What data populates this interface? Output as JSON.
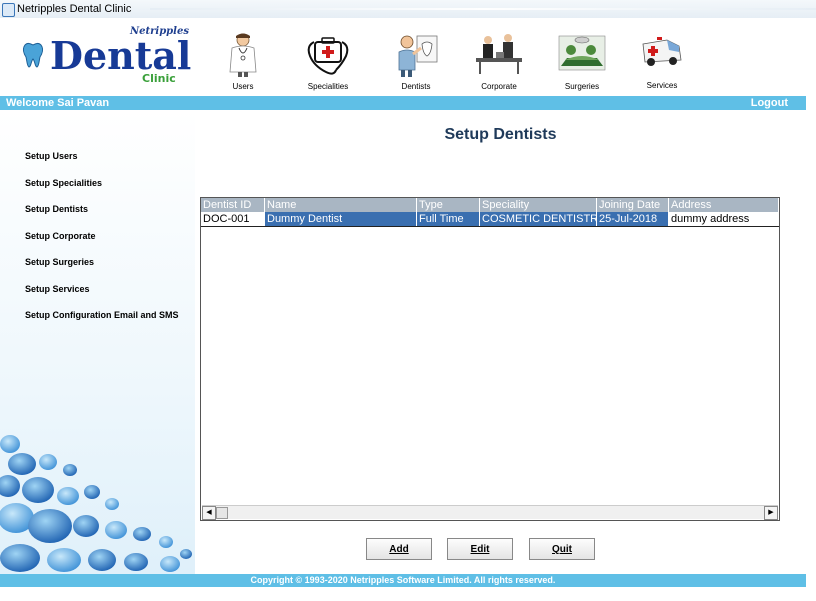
{
  "window": {
    "title": "Netripples Dental Clinic"
  },
  "logo": {
    "brand_small": "Netripples",
    "brand_main": "Dental",
    "brand_sub": "Clinic"
  },
  "nav": [
    {
      "id": "users",
      "label": "Users",
      "icon": "doctor-icon"
    },
    {
      "id": "specialities",
      "label": "Specialities",
      "icon": "medical-kit-icon"
    },
    {
      "id": "dentists",
      "label": "Dentists",
      "icon": "dentist-icon"
    },
    {
      "id": "corporate",
      "label": "Corporate",
      "icon": "corporate-icon"
    },
    {
      "id": "surgeries",
      "label": "Surgeries",
      "icon": "surgery-icon"
    },
    {
      "id": "services",
      "label": "Services",
      "icon": "ambulance-icon"
    }
  ],
  "welcome": {
    "text": "Welcome  Sai Pavan",
    "logout": "Logout"
  },
  "sidebar": {
    "items": [
      "Setup Users",
      "Setup Specialities",
      "Setup Dentists",
      "Setup Corporate",
      "Setup Surgeries",
      "Setup Services",
      "Setup Configuration Email and SMS"
    ]
  },
  "main": {
    "title": "Setup Dentists",
    "table": {
      "columns": [
        "Dentist ID",
        "Name",
        "Type",
        "Speciality",
        "Joining Date",
        "Address"
      ],
      "rows": [
        [
          "DOC-001",
          "Dummy Dentist",
          "Full Time",
          "COSMETIC DENTISTRY",
          "25-Jul-2018",
          "dummy address"
        ]
      ]
    },
    "buttons": {
      "add": "Add",
      "edit": "Edit",
      "quit": "Quit"
    }
  },
  "footer": {
    "copyright": "Copyright © 1993-2020 Netripples Software Limited. All rights reserved."
  },
  "colors": {
    "accent": "#5fbfe6",
    "selected_row": "#3a6fb0",
    "header": "#a9b6c3",
    "brand": "#173a96"
  }
}
